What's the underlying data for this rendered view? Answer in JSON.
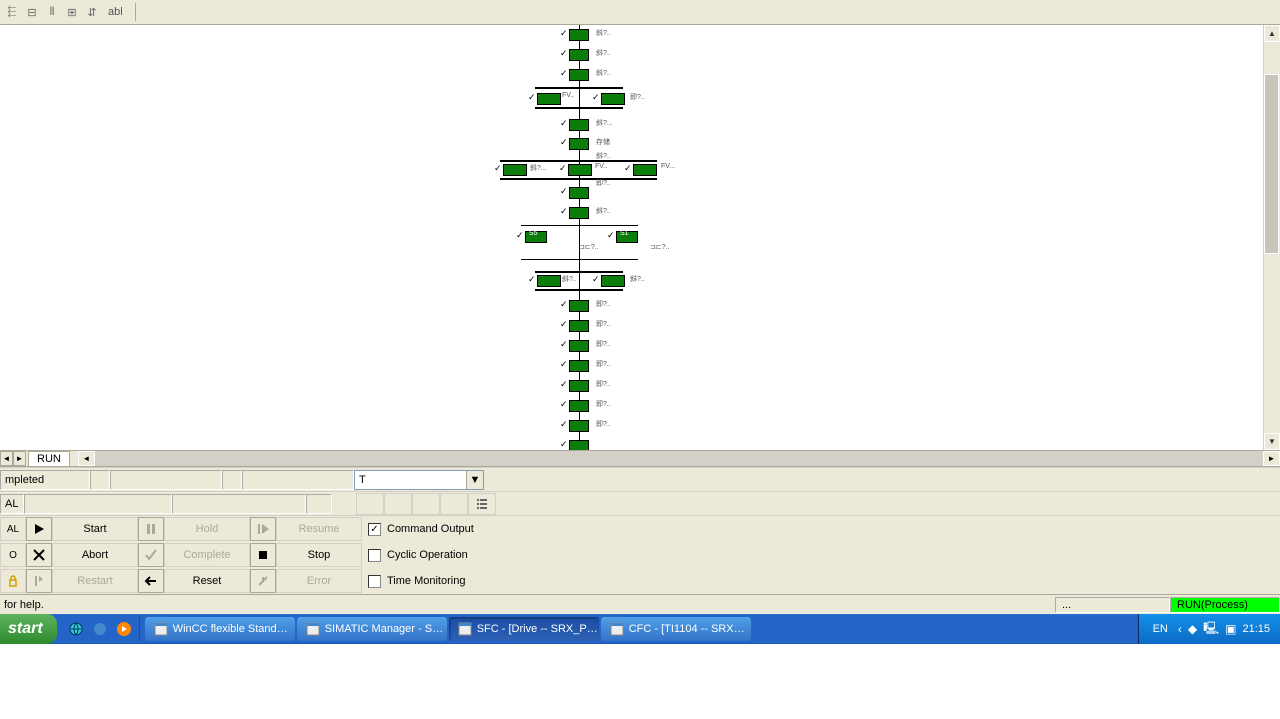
{
  "toolbar": {
    "text_label": "abl"
  },
  "bottom_tab": {
    "label": "RUN"
  },
  "status": {
    "left_label": "mpleted",
    "dropdown_value": "T",
    "second_label": "AL"
  },
  "controls": {
    "col1_labels": [
      "AL",
      "O",
      ""
    ],
    "buttons": {
      "start": "Start",
      "hold": "Hold",
      "resume": "Resume",
      "abort": "Abort",
      "complete": "Complete",
      "stop": "Stop",
      "restart": "Restart",
      "reset": "Reset",
      "error": "Error"
    },
    "checkboxes": {
      "command_output": {
        "label": "Command Output",
        "checked": true
      },
      "cyclic_operation": {
        "label": "Cyclic Operation",
        "checked": false
      },
      "time_monitoring": {
        "label": "Time Monitoring",
        "checked": false
      }
    }
  },
  "helpbar": {
    "text": "for help.",
    "dots": "...",
    "status": "RUN(Process)"
  },
  "taskbar": {
    "start": "start",
    "tasks": [
      {
        "label": "WinCC flexible Stand…",
        "active": false
      },
      {
        "label": "SIMATIC Manager - S…",
        "active": false
      },
      {
        "label": "SFC - [Drive -- SRX_P…",
        "active": true
      },
      {
        "label": "CFC - [TI1104 -- SRX…",
        "active": false
      }
    ],
    "lang": "EN",
    "clock": "21:15"
  }
}
